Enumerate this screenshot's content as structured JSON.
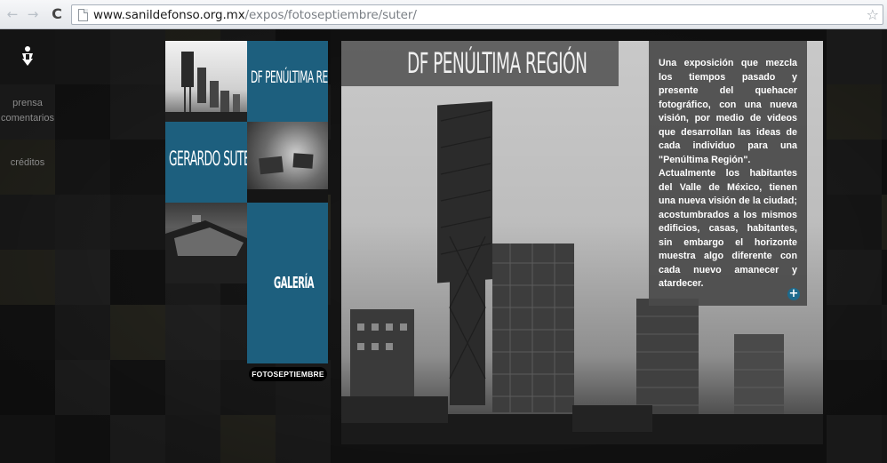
{
  "browser": {
    "url_host": "www.sanildefonso.org.mx",
    "url_path": "/expos/fotoseptiembre/suter/",
    "back_icon": "←",
    "forward_icon": "→",
    "reload_icon": "C",
    "star_icon": "☆"
  },
  "sidebar": {
    "prensa": "prensa",
    "comentarios": "comentarios",
    "creditos": "créditos"
  },
  "mosaic": {
    "df_tile": "DF PENÚLTIMA REGIÓN",
    "gerardo_tile": "GERARDO SUTER",
    "galeria_tile": "GALERÍA",
    "button": "FOTOSEPTIEMBRE"
  },
  "main": {
    "title": "DF PENÚLTIMA REGIÓN",
    "description": [
      "Una exposición que mezcla los tiempos pasado y presente del quehacer fotográfico, con una nueva visión, por medio de videos que desarrollan las ideas de cada individuo para una \"Penúltima Región\".",
      "Actualmente los habitantes del Valle de México, tienen una nueva visión de la ciudad; acostumbrados a los mismos edificios, casas, habitantes, sin embargo el horizonte muestra algo diferente con cada nuevo amanecer y atardecer."
    ],
    "more_icon": "+"
  },
  "colors": {
    "accent_blue": "#1d5f7e",
    "panel_gray": "#4a4a4a",
    "background": "#1b1b1b"
  }
}
